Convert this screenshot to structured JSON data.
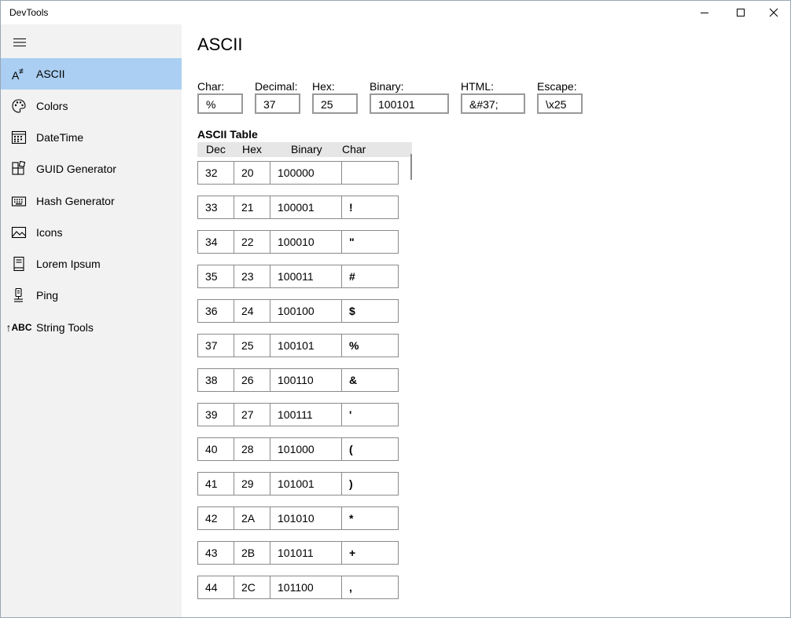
{
  "window": {
    "title": "DevTools"
  },
  "sidebar": {
    "items": [
      {
        "label": "ASCII",
        "icon": "ascii-icon",
        "selected": true
      },
      {
        "label": "Colors",
        "icon": "palette-icon",
        "selected": false
      },
      {
        "label": "DateTime",
        "icon": "calendar-icon",
        "selected": false
      },
      {
        "label": "GUID Generator",
        "icon": "guid-blocks-icon",
        "selected": false
      },
      {
        "label": "Hash Generator",
        "icon": "keyboard-icon",
        "selected": false
      },
      {
        "label": "Icons",
        "icon": "image-icon",
        "selected": false
      },
      {
        "label": "Lorem Ipsum",
        "icon": "book-icon",
        "selected": false
      },
      {
        "label": "Ping",
        "icon": "ping-icon",
        "selected": false
      },
      {
        "label": "String Tools",
        "icon": "string-tools-icon",
        "icon_text": "ABC",
        "selected": false
      }
    ]
  },
  "main": {
    "title": "ASCII",
    "fields": [
      {
        "label": "Char:",
        "value": "%"
      },
      {
        "label": "Decimal:",
        "value": "37"
      },
      {
        "label": "Hex:",
        "value": "25"
      },
      {
        "label": "Binary:",
        "value": "100101"
      },
      {
        "label": "HTML:",
        "value": "&#37;"
      },
      {
        "label": "Escape:",
        "value": "\\x25"
      }
    ],
    "table": {
      "title": "ASCII Table",
      "columns": [
        "Dec",
        "Hex",
        "Binary",
        "Char"
      ],
      "rows": [
        [
          "32",
          "20",
          "100000",
          ""
        ],
        [
          "33",
          "21",
          "100001",
          "!"
        ],
        [
          "34",
          "22",
          "100010",
          "\""
        ],
        [
          "35",
          "23",
          "100011",
          "#"
        ],
        [
          "36",
          "24",
          "100100",
          "$"
        ],
        [
          "37",
          "25",
          "100101",
          "%"
        ],
        [
          "38",
          "26",
          "100110",
          "&"
        ],
        [
          "39",
          "27",
          "100111",
          "'"
        ],
        [
          "40",
          "28",
          "101000",
          "("
        ],
        [
          "41",
          "29",
          "101001",
          ")"
        ],
        [
          "42",
          "2A",
          "101010",
          "*"
        ],
        [
          "43",
          "2B",
          "101011",
          "+"
        ],
        [
          "44",
          "2C",
          "101100",
          ","
        ]
      ]
    }
  },
  "colors": {
    "selected": "#abcff2",
    "sidebar_bg": "#f2f2f2",
    "header_bg": "#e6e6e6"
  }
}
